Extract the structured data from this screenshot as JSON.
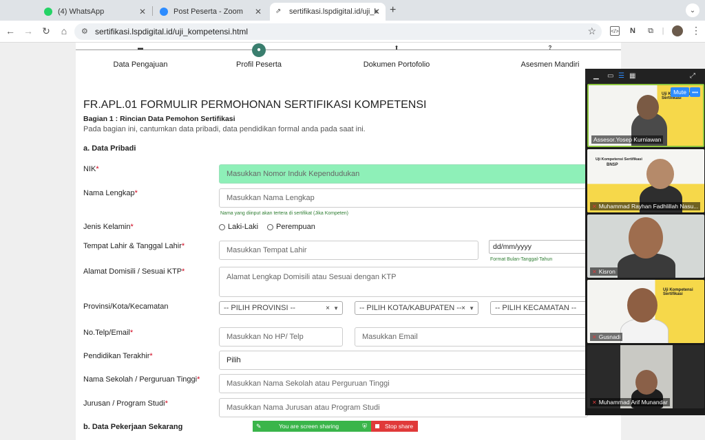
{
  "browser": {
    "tabs": [
      {
        "title": "(4) WhatsApp",
        "favicon": "whatsapp-icon"
      },
      {
        "title": "Post Peserta - Zoom",
        "favicon": "zoom-icon"
      },
      {
        "title": "sertifikasi.lspdigital.id/uji_kom",
        "favicon": "link-icon"
      }
    ],
    "new_tab": "+",
    "url": "sertifikasi.lspdigital.id/uji_kompetensi.html"
  },
  "stepper": {
    "steps": [
      {
        "label": "Data Pengajuan"
      },
      {
        "label": "Profil Peserta"
      },
      {
        "label": "Dokumen Portofolio"
      },
      {
        "label": "Asesmen Mandiri"
      }
    ],
    "active_index": 1
  },
  "form": {
    "title": "FR.APL.01 FORMULIR PERMOHONAN SERTIFIKASI KOMPETENSI",
    "subtitle": "Bagian 1 : Rincian Data Pemohon Sertifikasi",
    "description": "Pada bagian ini, cantumkan data pribadi, data pendidikan formal anda pada saat ini.",
    "section_a": "a. Data Pribadi",
    "section_b": "b. Data Pekerjaan Sekarang",
    "required_mark": "*",
    "fields": {
      "nik": {
        "label": "NIK",
        "placeholder": "Masukkan Nomor Induk Kependudukan"
      },
      "nama": {
        "label": "Nama Lengkap",
        "placeholder": "Masukkan Nama Lengkap",
        "hint": "Nama yang diinput akan tertera di sertifikat (Jika Kompeten)"
      },
      "jk": {
        "label": "Jenis Kelamin",
        "options": [
          "Laki-Laki",
          "Perempuan"
        ]
      },
      "ttl": {
        "label": "Tempat Lahir & Tanggal Lahir",
        "placeholder": "Masukkan Tempat Lahir",
        "date_placeholder": "dd/mm/yyyy",
        "hint": "Format Bulan-Tanggal-Tahun"
      },
      "alamat": {
        "label": "Alamat Domisili / Sesuai KTP",
        "placeholder": "Alamat Lengkap Domisili atau Sesuai dengan KTP"
      },
      "wilayah": {
        "label": "Provinsi/Kota/Kecamatan",
        "provinsi": "-- PILIH PROVINSI --",
        "kota": "-- PILIH KOTA/KABUPATEN --",
        "kecamatan": "-- PILIH KECAMATAN --"
      },
      "kontak": {
        "label": "No.Telp/Email",
        "hp_placeholder": "Masukkan No HP/ Telp",
        "email_placeholder": "Masukkan Email"
      },
      "pendidikan": {
        "label": "Pendidikan Terakhir",
        "value": "Pilih"
      },
      "sekolah": {
        "label": "Nama Sekolah / Perguruan Tinggi",
        "placeholder": "Masukkan Nama Sekolah atau Perguruan Tinggi"
      },
      "jurusan": {
        "label": "Jurusan / Program Studi",
        "placeholder": "Masukkan Nama Jurusan atau Program Studi"
      }
    }
  },
  "screen_share": {
    "status": "You are screen sharing",
    "stop": "Stop share"
  },
  "zoom": {
    "mute_label": "Mute",
    "more_label": "•••",
    "participants": [
      {
        "name": "Assesor.Yosep Kurniawan",
        "muted": false
      },
      {
        "name": "Muhammad Rayhan Fadhlillah Nasu...",
        "muted": true
      },
      {
        "name": "Kisron",
        "muted": true
      },
      {
        "name": "Gusnadi",
        "muted": true
      },
      {
        "name": "Muhammad Arif Munandar",
        "muted": true
      }
    ],
    "bnsp_text": "BNSP",
    "uji_text": "Uji Kompetensi Sertifikasi"
  }
}
